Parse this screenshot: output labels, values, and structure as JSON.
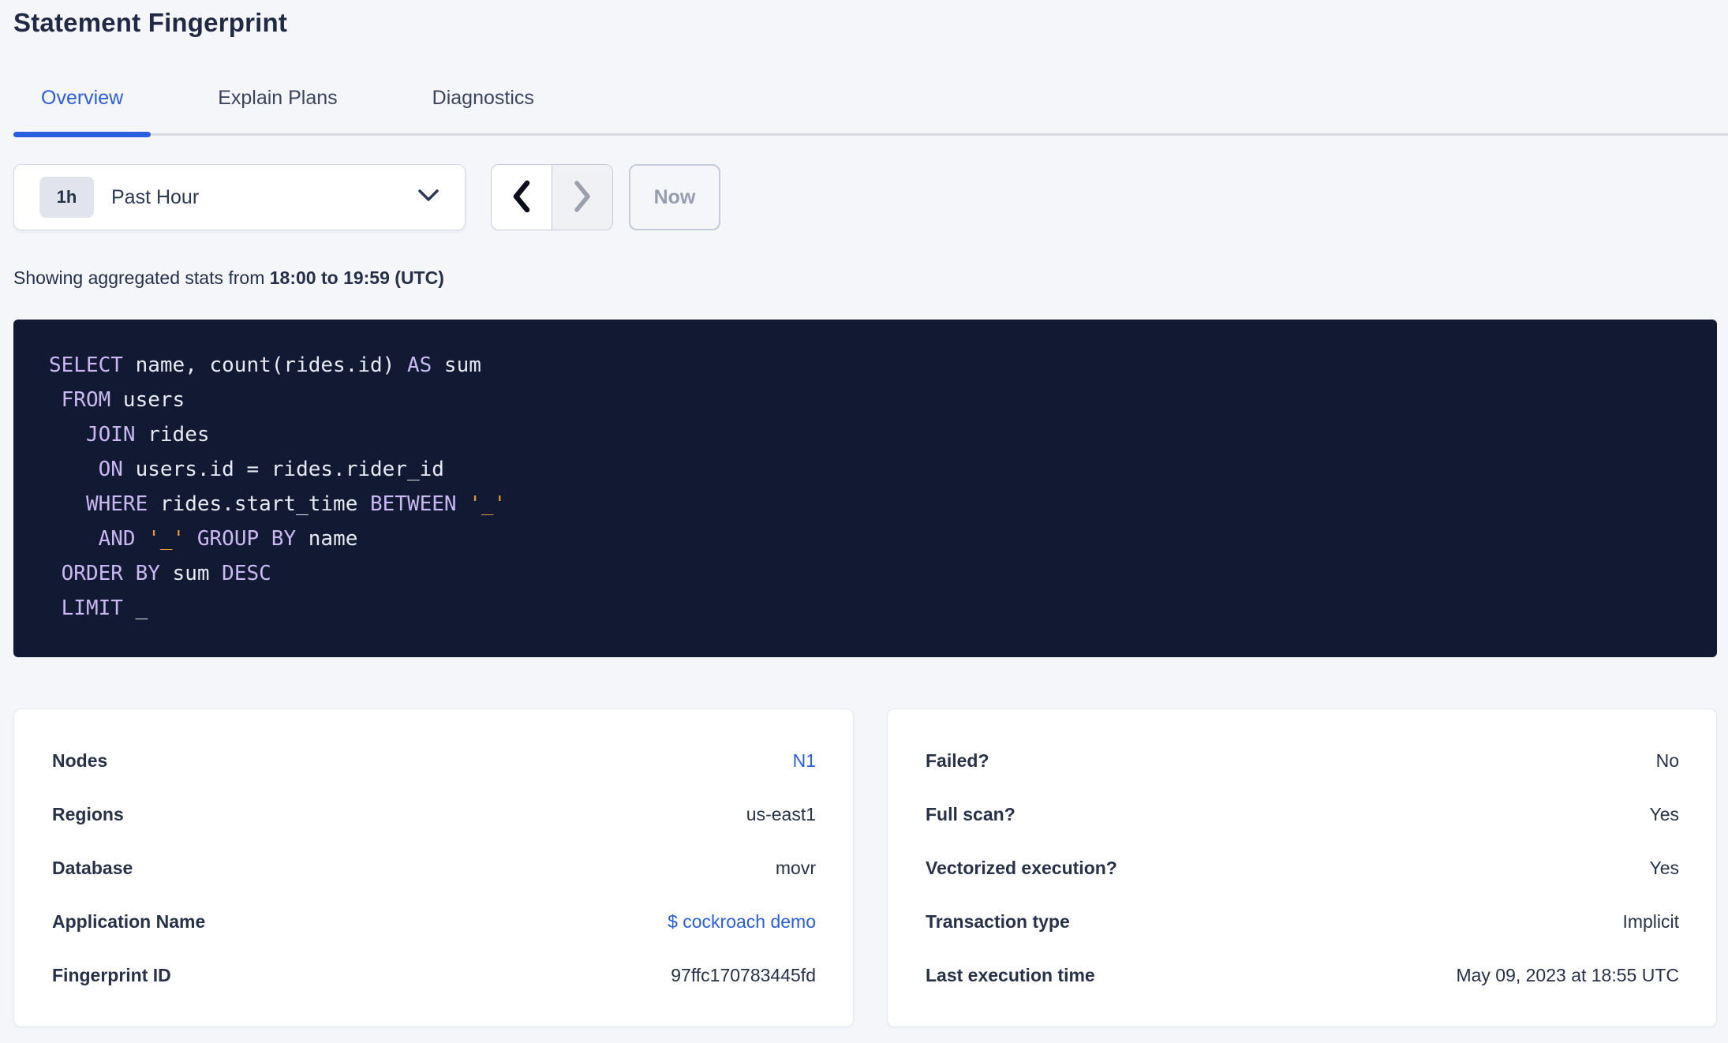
{
  "page": {
    "title": "Statement Fingerprint"
  },
  "tabs": [
    {
      "label": "Overview",
      "active": true
    },
    {
      "label": "Explain Plans",
      "active": false
    },
    {
      "label": "Diagnostics",
      "active": false
    }
  ],
  "time_controls": {
    "range_badge": "1h",
    "range_label": "Past Hour",
    "now_label": "Now",
    "prev_enabled": true,
    "next_enabled": false,
    "icons": {
      "dropdown": "chevron-down-icon",
      "prev": "chevron-left-icon",
      "next": "chevron-right-icon"
    }
  },
  "stats_line": {
    "prefix": "Showing aggregated stats from ",
    "range_bold": "18:00 to 19:59 (UTC)"
  },
  "sql": {
    "lines": [
      {
        "tokens": [
          {
            "t": "kw",
            "v": "SELECT"
          },
          {
            "t": "pl",
            "v": " name, count(rides.id) "
          },
          {
            "t": "kw",
            "v": "AS"
          },
          {
            "t": "pl",
            "v": " sum"
          }
        ]
      },
      {
        "tokens": [
          {
            "t": "pl",
            "v": " "
          },
          {
            "t": "kw",
            "v": "FROM"
          },
          {
            "t": "pl",
            "v": " users"
          }
        ]
      },
      {
        "tokens": [
          {
            "t": "pl",
            "v": "   "
          },
          {
            "t": "kw",
            "v": "JOIN"
          },
          {
            "t": "pl",
            "v": " rides"
          }
        ]
      },
      {
        "tokens": [
          {
            "t": "pl",
            "v": "    "
          },
          {
            "t": "kw",
            "v": "ON"
          },
          {
            "t": "pl",
            "v": " users.id = rides.rider_id"
          }
        ]
      },
      {
        "tokens": [
          {
            "t": "pl",
            "v": "   "
          },
          {
            "t": "kw",
            "v": "WHERE"
          },
          {
            "t": "pl",
            "v": " rides.start_time "
          },
          {
            "t": "kw",
            "v": "BETWEEN"
          },
          {
            "t": "pl",
            "v": " "
          },
          {
            "t": "str",
            "v": "'_'"
          }
        ]
      },
      {
        "tokens": [
          {
            "t": "pl",
            "v": "    "
          },
          {
            "t": "kw",
            "v": "AND"
          },
          {
            "t": "pl",
            "v": " "
          },
          {
            "t": "str",
            "v": "'_'"
          },
          {
            "t": "pl",
            "v": " "
          },
          {
            "t": "kw",
            "v": "GROUP BY"
          },
          {
            "t": "pl",
            "v": " name"
          }
        ]
      },
      {
        "tokens": [
          {
            "t": "pl",
            "v": " "
          },
          {
            "t": "kw",
            "v": "ORDER BY"
          },
          {
            "t": "pl",
            "v": " sum "
          },
          {
            "t": "kw",
            "v": "DESC"
          }
        ]
      },
      {
        "tokens": [
          {
            "t": "pl",
            "v": " "
          },
          {
            "t": "kw",
            "v": "LIMIT"
          },
          {
            "t": "pl",
            "v": " _"
          }
        ]
      }
    ]
  },
  "cards": {
    "left": {
      "rows": [
        {
          "label": "Nodes",
          "value": "N1",
          "link": true
        },
        {
          "label": "Regions",
          "value": "us-east1",
          "link": false
        },
        {
          "label": "Database",
          "value": "movr",
          "link": false
        },
        {
          "label": "Application Name",
          "value": "$ cockroach demo",
          "link": true
        },
        {
          "label": "Fingerprint ID",
          "value": "97ffc170783445fd",
          "link": false
        }
      ]
    },
    "right": {
      "rows": [
        {
          "label": "Failed?",
          "value": "No"
        },
        {
          "label": "Full scan?",
          "value": "Yes"
        },
        {
          "label": "Vectorized execution?",
          "value": "Yes"
        },
        {
          "label": "Transaction type",
          "value": "Implicit"
        },
        {
          "label": "Last execution time",
          "value": "May 09, 2023 at 18:55 UTC"
        }
      ]
    }
  },
  "colors": {
    "accent_blue": "#2b5dde",
    "page_bg": "#f4f6fa",
    "text_dark": "#232e49",
    "sql_bg": "#121a33",
    "sql_keyword": "#c9b8f2",
    "sql_plain": "#e7eaf3",
    "sql_string": "#e09a3f",
    "disabled_gray": "#959daf"
  }
}
